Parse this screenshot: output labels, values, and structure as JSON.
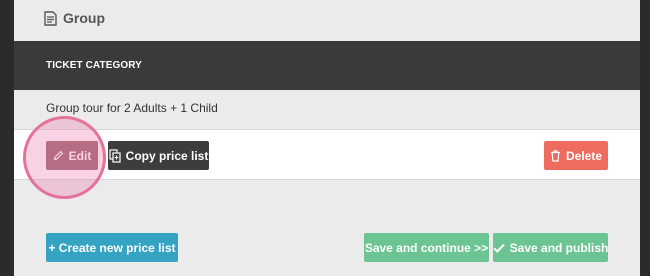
{
  "header": {
    "title": "Group",
    "icon": "document-icon"
  },
  "category_bar": {
    "label": "TICKET CATEGORY"
  },
  "ticket": {
    "name": "Group tour for 2 Adults + 1 Child"
  },
  "actions": {
    "edit_label": "Edit",
    "copy_label": "Copy price list",
    "delete_label": "Delete"
  },
  "footer": {
    "create_label": "+ Create new price list",
    "save_continue_label": "Save and continue >>",
    "save_publish_label": "Save and publish"
  },
  "colors": {
    "edit": "#9b6770",
    "copy": "#3d3d3d",
    "delete": "#ee6c5f",
    "create": "#35a3c2",
    "save": "#6bc491",
    "bar": "#3a3a3a"
  }
}
